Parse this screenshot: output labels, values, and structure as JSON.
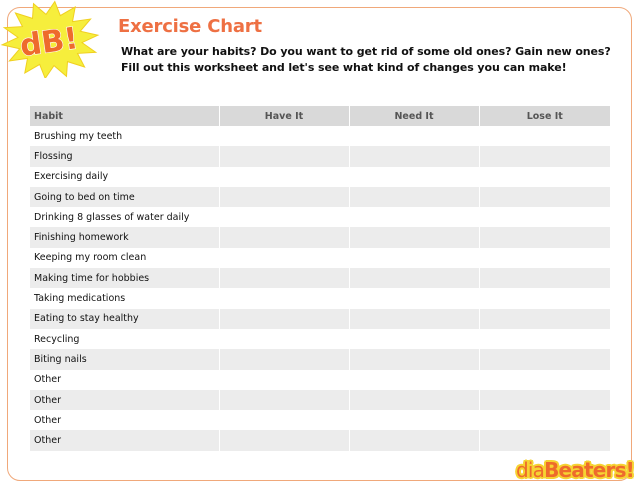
{
  "logo": {
    "text": "dB!",
    "burst_color": "#f6ee3c",
    "text_color": "#ee6b2c"
  },
  "title": "Exercise Chart",
  "intro": [
    "What are your habits? Do you want to get rid of some old ones? Gain new ones?",
    "Fill out this worksheet and let's see what kind of changes you can make!"
  ],
  "table": {
    "headers": [
      "Habit",
      "Have It",
      "Need It",
      "Lose It"
    ],
    "rows": [
      "Brushing my teeth",
      "Flossing",
      "Exercising daily",
      "Going to bed on time",
      "Drinking 8 glasses of water daily",
      "Finishing homework",
      "Keeping my room clean",
      "Making time for hobbies",
      "Taking medications",
      "Eating to stay healthy",
      "Recycling",
      "Biting nails",
      "Other",
      "Other",
      "Other",
      "Other"
    ]
  },
  "brand": {
    "part1": "dia",
    "part2": "Beaters!"
  },
  "colors": {
    "accent": "#ee7043",
    "frame": "#f0a87a",
    "header_bg": "#d9d9d9",
    "stripe": "#ececec"
  }
}
